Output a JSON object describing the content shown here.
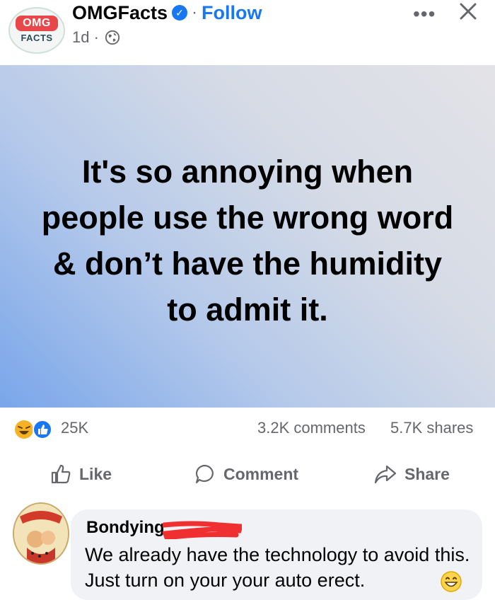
{
  "header": {
    "avatar_top": "OMG",
    "avatar_bottom": "FACTS",
    "page_name": "OMGFacts",
    "verified_icon": "verified-badge-icon",
    "separator": "·",
    "follow_label": "Follow",
    "time": "1d ·",
    "privacy_icon": "globe-icon",
    "more_label": "•••"
  },
  "post": {
    "text": "It's so annoying when people use the wrong word & don’t have the humidity to admit it."
  },
  "stats": {
    "reactions": "25K",
    "comments": "3.2K comments",
    "shares": "5.7K shares"
  },
  "actions": {
    "like": "Like",
    "comment": "Comment",
    "share": "Share"
  },
  "comment": {
    "author": "Bondying",
    "text": "We already have the technology to avoid this. Just turn on your your auto erect."
  },
  "colors": {
    "accent": "#1877f2",
    "secondary_text": "#65676b",
    "bubble": "#f0f2f5"
  }
}
